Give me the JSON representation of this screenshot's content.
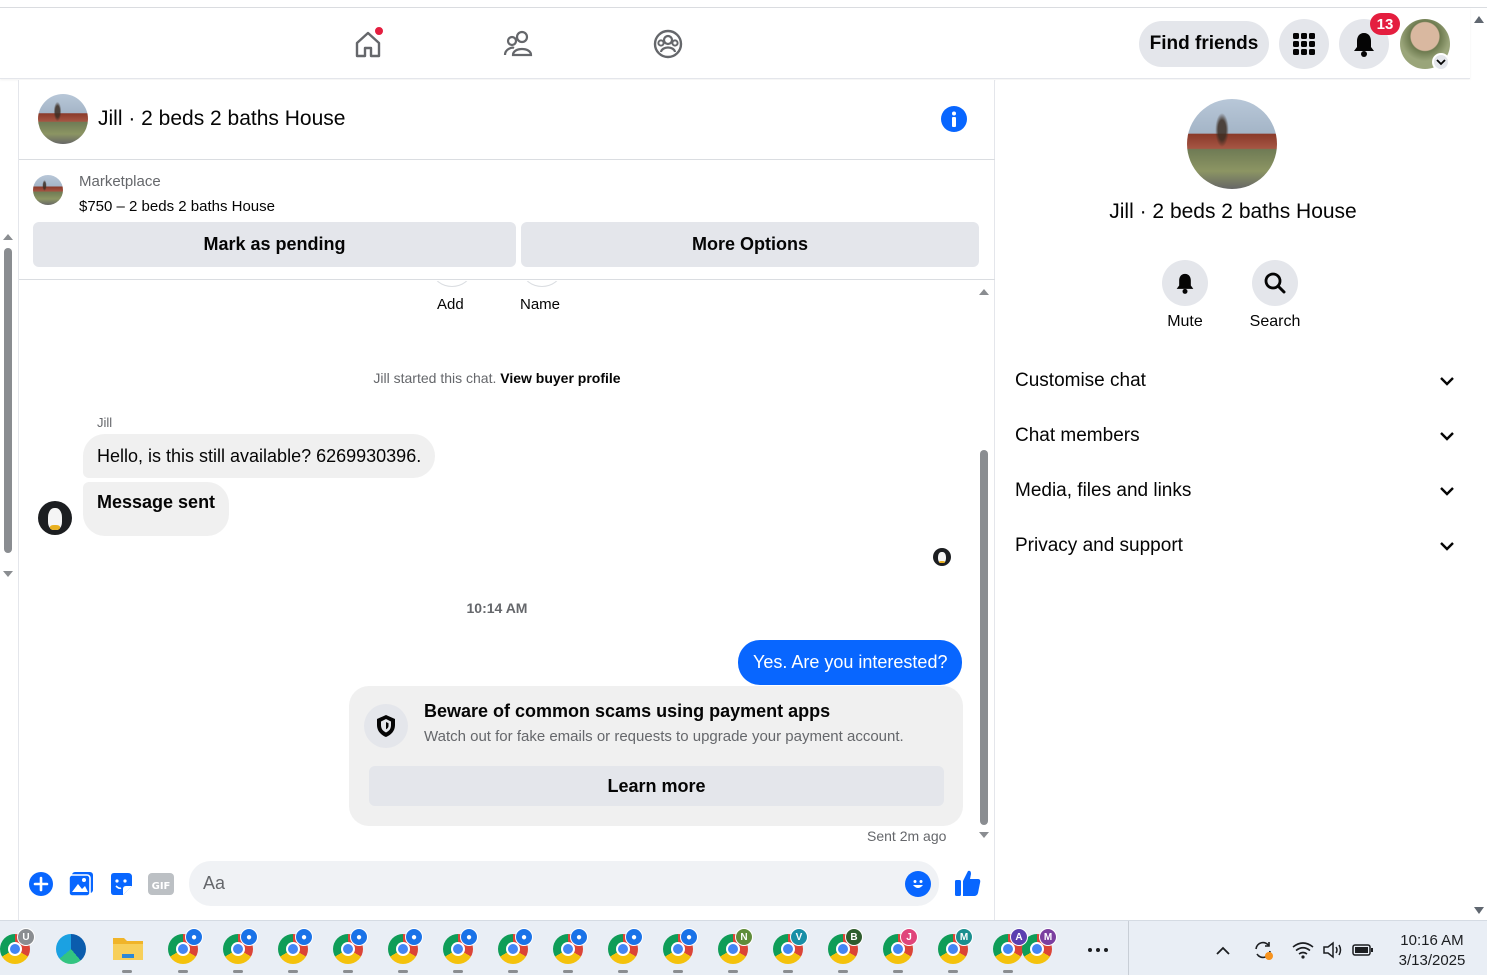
{
  "topbar": {
    "find_friends_label": "Find friends",
    "notification_count": "13"
  },
  "chat": {
    "title": "Jill · 2 beds 2 baths House",
    "marketplace_label": "Marketplace",
    "listing": "$750 – 2 beds 2 baths House",
    "mark_pending_label": "Mark as pending",
    "more_options_label": "More Options",
    "top_actions": [
      "Add",
      "Name"
    ],
    "system_line_text": "Jill started this chat.",
    "system_line_link": "View buyer profile",
    "sender_name": "Jill",
    "incoming": [
      "Hello, is this still available? 6269930396.",
      "Message sent"
    ],
    "timestamp": "10:14 AM",
    "outgoing": "Yes. Are you interested?",
    "scam_card": {
      "title": "Beware of common scams using payment apps",
      "text": "Watch out for fake emails or requests to upgrade your payment account.",
      "button": "Learn more"
    },
    "sent_status": "Sent 2m ago",
    "composer_placeholder": "Aa"
  },
  "right_panel": {
    "name": "Jill · 2 beds 2 baths House",
    "actions": [
      "Mute",
      "Search"
    ],
    "sections": [
      "Customise chat",
      "Chat members",
      "Media, files and links",
      "Privacy and support"
    ]
  },
  "taskbar": {
    "badges": [
      "U",
      "N",
      "V",
      "B",
      "J",
      "M",
      "A",
      "M"
    ],
    "time": "10:16 AM",
    "date": "3/13/2025"
  },
  "colors": {
    "accent": "#0866ff",
    "notification": "#e41e3f",
    "bubble_in": "#f0f0f0",
    "button_bg": "#e4e6eb"
  }
}
